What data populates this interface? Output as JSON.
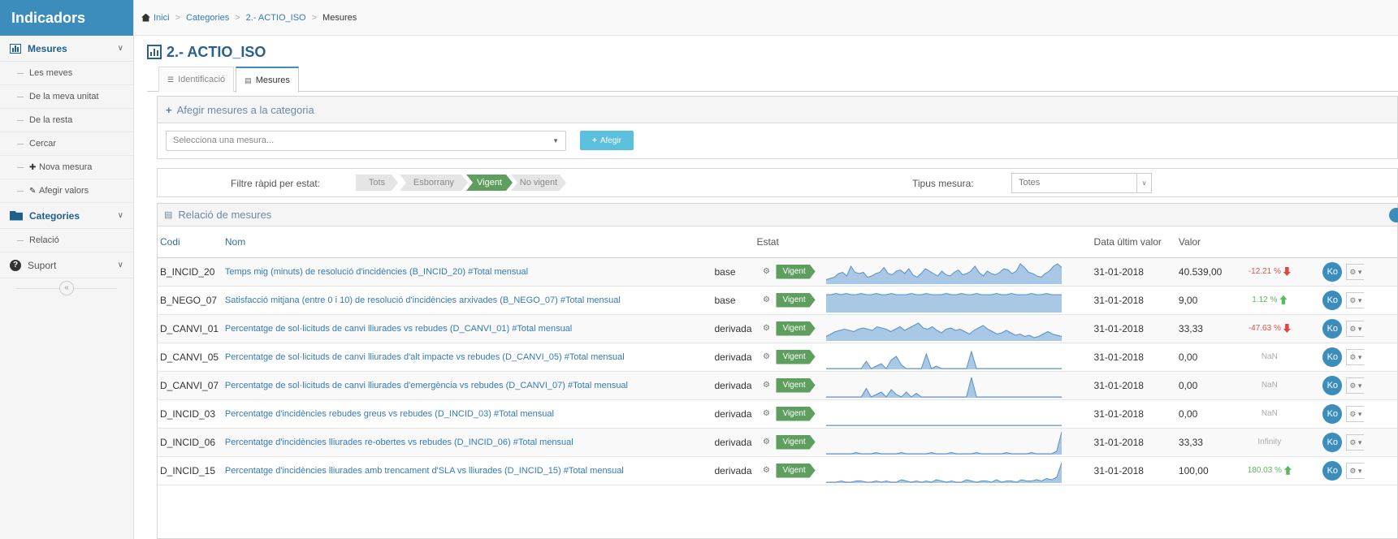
{
  "brand": "Indicadors",
  "sidebar": {
    "sections": [
      {
        "label": "Mesures",
        "icon": "bar-chart-icon",
        "items": [
          {
            "label": "Les meves",
            "icon": ""
          },
          {
            "label": "De la meva unitat",
            "icon": ""
          },
          {
            "label": "De la resta",
            "icon": ""
          },
          {
            "label": "Cercar",
            "icon": ""
          },
          {
            "label": "Nova mesura",
            "icon": "plus-icon"
          },
          {
            "label": "Afegir valors",
            "icon": "pencil-icon"
          }
        ]
      },
      {
        "label": "Categories",
        "icon": "folder-open-icon",
        "items": [
          {
            "label": "Relació",
            "icon": ""
          }
        ]
      },
      {
        "label": "Suport",
        "icon": "question-circle-icon",
        "items": []
      }
    ]
  },
  "breadcrumb": [
    "Inici",
    "Categories",
    "2.- ACTIO_ISO",
    "Mesures"
  ],
  "page_title": "2.- ACTIO_ISO",
  "tabs": [
    {
      "label": "Identificació",
      "icon": "list-icon",
      "active": false
    },
    {
      "label": "Mesures",
      "icon": "bar-chart-icon",
      "active": true
    }
  ],
  "add_panel": {
    "title": "Afegir mesures a la categoria",
    "select_placeholder": "Selecciona una mesura...",
    "add_button": "Afegir"
  },
  "filter": {
    "label": "Filtre ràpid per estat:",
    "chips": [
      "Tots",
      "Esborrany",
      "Vigent",
      "No vigent"
    ],
    "active": "Vigent",
    "tipus_label": "Tipus mesura:",
    "tipus_value": "Totes"
  },
  "list_title": "Relació de mesures",
  "columns": {
    "codi": "Codi",
    "nom": "Nom",
    "estat": "Estat",
    "data": "Data últim valor",
    "valor": "Valor"
  },
  "rows": [
    {
      "codi": "B_INCID_20",
      "nom": "Temps mig (minuts) de resolució d'incidències (B_INCID_20) #Total mensual",
      "tipus": "base",
      "estat": "Vigent",
      "data": "31-01-2018",
      "valor": "40.539,00",
      "pct": "-12.21 %",
      "trend": "down",
      "action": "Ko",
      "spark": [
        3,
        4,
        5,
        8,
        9,
        6,
        14,
        9,
        8,
        9,
        5,
        6,
        8,
        9,
        13,
        8,
        7,
        10,
        11,
        8,
        12,
        7,
        5,
        8,
        12,
        10,
        8,
        6,
        10,
        7,
        6,
        9,
        11,
        7,
        8,
        10,
        14,
        9,
        6,
        10,
        8,
        7,
        9,
        12,
        11,
        8,
        10,
        16,
        13,
        9,
        8,
        6,
        5,
        8,
        10,
        14,
        16,
        13
      ]
    },
    {
      "codi": "B_NEGO_07",
      "nom": "Satisfacció mitjana (entre 0 i 10) de resolució d'incidències arxivades (B_NEGO_07) #Total mensual",
      "tipus": "base",
      "estat": "Vigent",
      "data": "31-01-2018",
      "valor": "9,00",
      "pct": "1.12 %",
      "trend": "up",
      "action": "Ko",
      "spark": [
        14,
        14,
        15,
        14,
        15,
        14,
        14,
        15,
        14,
        14,
        15,
        14,
        14,
        15,
        14,
        14,
        14,
        15,
        14,
        14,
        15,
        14,
        14,
        14,
        15,
        14,
        14,
        15,
        14,
        14,
        15,
        14,
        14,
        14,
        15,
        14,
        14,
        15,
        14,
        14,
        14,
        15,
        14,
        14,
        15,
        14,
        14,
        14
      ]
    },
    {
      "codi": "D_CANVI_01",
      "nom": "Percentatge de sol·licituds de canvi lliurades vs rebudes (D_CANVI_01) #Total mensual",
      "tipus": "derivada",
      "estat": "Vigent",
      "data": "31-01-2018",
      "valor": "33,33",
      "pct": "-47.63 %",
      "trend": "down",
      "action": "Ko",
      "spark": [
        3,
        5,
        7,
        8,
        9,
        8,
        7,
        9,
        10,
        9,
        8,
        11,
        10,
        9,
        7,
        9,
        11,
        8,
        10,
        12,
        14,
        10,
        9,
        11,
        8,
        6,
        9,
        10,
        8,
        9,
        7,
        5,
        8,
        10,
        12,
        9,
        7,
        5,
        6,
        8,
        6,
        4,
        5,
        3,
        4,
        2,
        3,
        5,
        7,
        5,
        4,
        3
      ]
    },
    {
      "codi": "D_CANVI_05",
      "nom": "Percentatge de sol·licituds de canvi lliurades d'alt impacte vs rebudes (D_CANVI_05) #Total mensual",
      "tipus": "derivada",
      "estat": "Vigent",
      "data": "31-01-2018",
      "valor": "0,00",
      "pct": "NaN",
      "trend": "",
      "action": "Ko",
      "spark": [
        0,
        0,
        0,
        0,
        0,
        0,
        0,
        0,
        6,
        0,
        2,
        4,
        0,
        7,
        10,
        3,
        0,
        0,
        0,
        0,
        12,
        0,
        2,
        0,
        0,
        0,
        0,
        0,
        0,
        14,
        0,
        0,
        0,
        0,
        0,
        0,
        0,
        0,
        0,
        0,
        0,
        0,
        0,
        0,
        0,
        0,
        0,
        0
      ]
    },
    {
      "codi": "D_CANVI_07",
      "nom": "Percentatge de sol·licituds de canvi lliurades d'emergència vs rebudes (D_CANVI_07) #Total mensual",
      "tipus": "derivada",
      "estat": "Vigent",
      "data": "31-01-2018",
      "valor": "0,00",
      "pct": "NaN",
      "trend": "",
      "action": "Ko",
      "spark": [
        0,
        0,
        0,
        0,
        0,
        0,
        0,
        0,
        7,
        0,
        2,
        4,
        0,
        6,
        2,
        0,
        4,
        0,
        3,
        0,
        0,
        0,
        0,
        0,
        0,
        0,
        0,
        0,
        0,
        16,
        0,
        0,
        0,
        0,
        0,
        0,
        0,
        0,
        0,
        0,
        0,
        0,
        0,
        0,
        0,
        0,
        0,
        0
      ]
    },
    {
      "codi": "D_INCID_03",
      "nom": "Percentatge d'incidències rebudes greus vs rebudes (D_INCID_03) #Total mensual",
      "tipus": "derivada",
      "estat": "Vigent",
      "data": "31-01-2018",
      "valor": "0,00",
      "pct": "NaN",
      "trend": "",
      "action": "Ko",
      "spark": [
        0,
        0,
        0,
        0,
        0,
        0,
        0,
        0,
        0,
        0,
        0,
        0,
        0,
        0,
        0,
        0,
        0,
        0,
        0,
        0,
        0,
        0,
        0,
        0,
        0,
        0,
        0,
        0,
        0,
        0,
        0,
        0,
        0,
        0,
        0,
        0,
        0,
        0,
        0,
        0,
        0,
        0,
        0,
        0,
        0,
        0,
        0,
        0
      ]
    },
    {
      "codi": "D_INCID_06",
      "nom": "Percentatge d'incidències lliurades re-obertes vs rebudes (D_INCID_06) #Total mensual",
      "tipus": "derivada",
      "estat": "Vigent",
      "data": "31-01-2018",
      "valor": "33,33",
      "pct": "Infinity",
      "trend": "",
      "action": "Ko",
      "spark": [
        0,
        0,
        0,
        0,
        0,
        0,
        1,
        0,
        0,
        0,
        1,
        0,
        0,
        0,
        0,
        1,
        0,
        0,
        0,
        0,
        0,
        1,
        0,
        0,
        0,
        1,
        0,
        0,
        0,
        0,
        1,
        0,
        0,
        0,
        0,
        0,
        1,
        0,
        0,
        0,
        0,
        1,
        0,
        0,
        0,
        0,
        2,
        18
      ]
    },
    {
      "codi": "D_INCID_15",
      "nom": "Percentatge d'incidències lliurades amb trencament d'SLA vs lliurades (D_INCID_15) #Total mensual",
      "tipus": "derivada",
      "estat": "Vigent",
      "data": "31-01-2018",
      "valor": "100,00",
      "pct": "180.03 %",
      "trend": "up",
      "action": "Ko",
      "spark": [
        0,
        0,
        0,
        1,
        0,
        0,
        1,
        1,
        0,
        0,
        1,
        0,
        1,
        0,
        0,
        2,
        1,
        0,
        1,
        0,
        1,
        0,
        2,
        1,
        0,
        1,
        0,
        0,
        2,
        1,
        0,
        1,
        1,
        0,
        2,
        0,
        1,
        1,
        0,
        2,
        1,
        1,
        2,
        1,
        3,
        2,
        4,
        16
      ]
    }
  ],
  "colors": {
    "brand": "#3c8dbc",
    "vigent": "#5e9e5e",
    "spark_fill": "#a9c8e6",
    "spark_line": "#5a8fc4",
    "neg": "#d9534f",
    "pos": "#5cb85c"
  }
}
